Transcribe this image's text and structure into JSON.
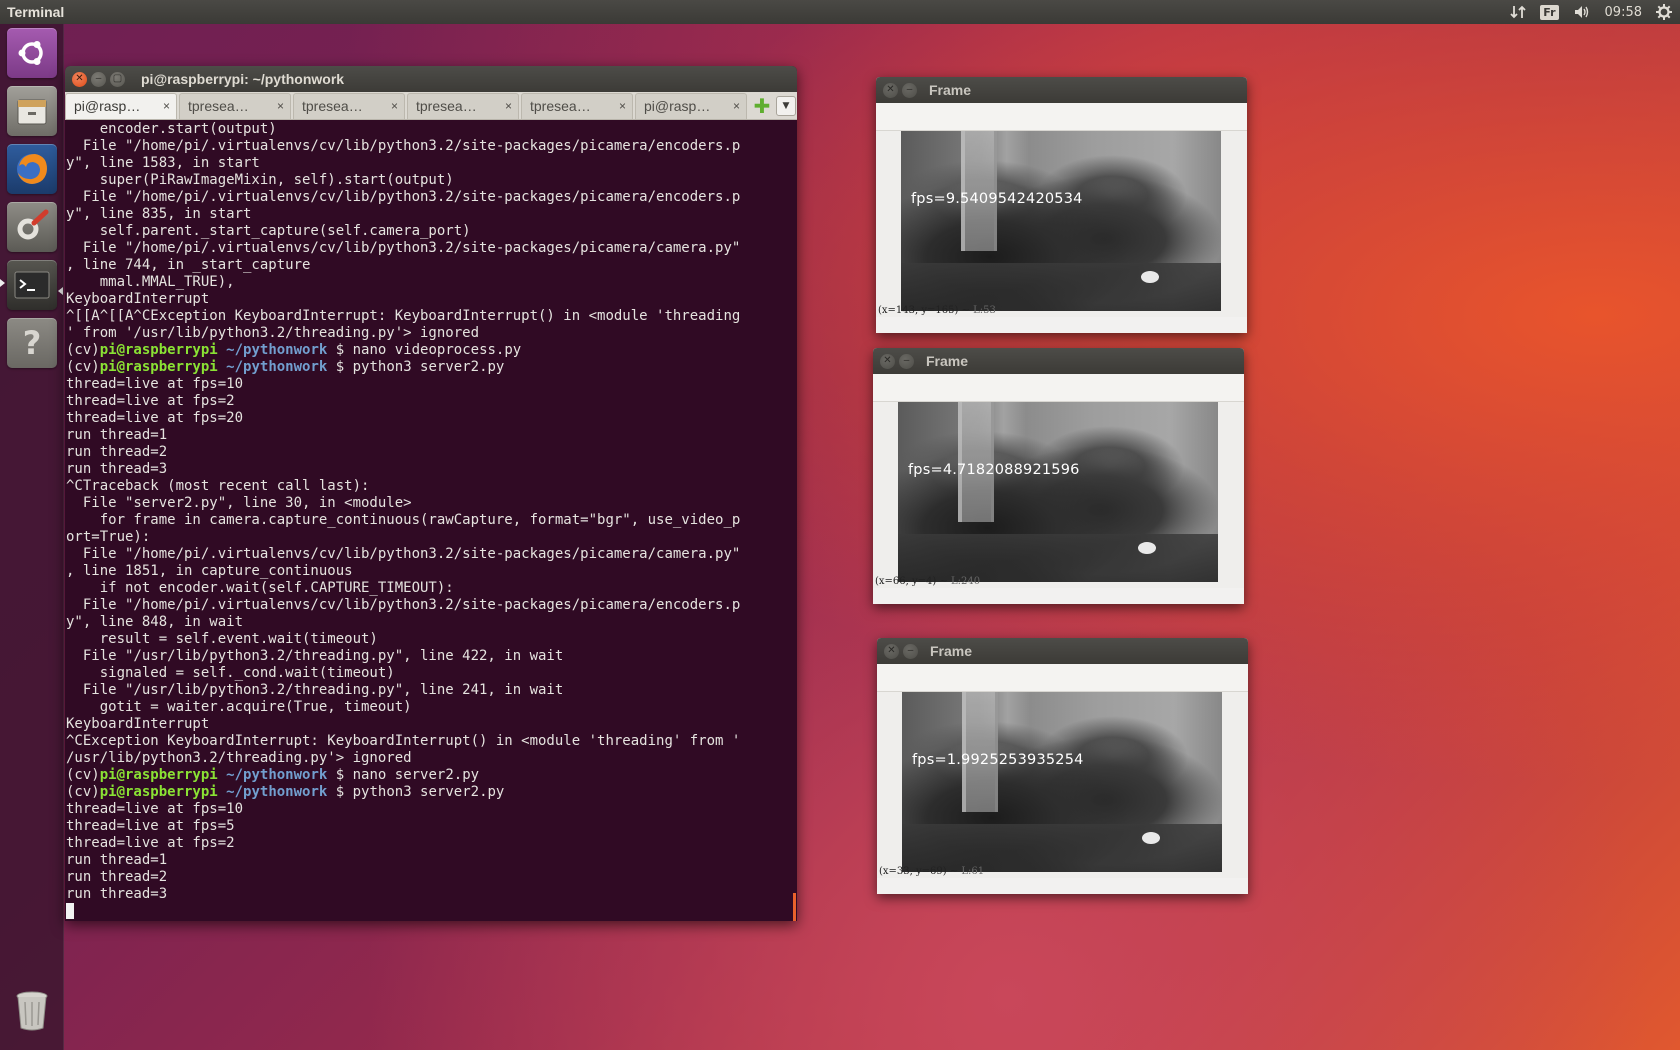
{
  "top_panel": {
    "app_title": "Terminal",
    "keyboard_layout": "Fr",
    "clock": "09:58",
    "icons": [
      "network-icon",
      "keyboard-icon",
      "volume-icon",
      "gear-icon"
    ]
  },
  "launcher": {
    "items": [
      "ubuntu-logo-icon",
      "files-icon",
      "firefox-icon",
      "system-settings-icon",
      "terminal-icon",
      "help-icon",
      "trash-icon"
    ]
  },
  "terminal": {
    "title": "pi@raspberrypi: ~/pythonwork",
    "tabs": [
      {
        "label": "pi@rasp…",
        "active": true
      },
      {
        "label": "tpresea…",
        "active": false
      },
      {
        "label": "tpresea…",
        "active": false
      },
      {
        "label": "tpresea…",
        "active": false
      },
      {
        "label": "tpresea…",
        "active": false
      },
      {
        "label": "pi@rasp…",
        "active": false
      }
    ],
    "tab_close_glyph": "×",
    "prompt_env": "(cv)",
    "prompt_user": "pi@raspberrypi",
    "prompt_path": "~/pythonwork",
    "prompt_symbol": "$",
    "lines": [
      {
        "type": "out",
        "text": "    encoder.start(output)"
      },
      {
        "type": "out",
        "text": "  File \"/home/pi/.virtualenvs/cv/lib/python3.2/site-packages/picamera/encoders.p"
      },
      {
        "type": "out",
        "text": "y\", line 1583, in start"
      },
      {
        "type": "out",
        "text": "    super(PiRawImageMixin, self).start(output)"
      },
      {
        "type": "out",
        "text": "  File \"/home/pi/.virtualenvs/cv/lib/python3.2/site-packages/picamera/encoders.p"
      },
      {
        "type": "out",
        "text": "y\", line 835, in start"
      },
      {
        "type": "out",
        "text": "    self.parent._start_capture(self.camera_port)"
      },
      {
        "type": "out",
        "text": "  File \"/home/pi/.virtualenvs/cv/lib/python3.2/site-packages/picamera/camera.py\""
      },
      {
        "type": "out",
        "text": ", line 744, in _start_capture"
      },
      {
        "type": "out",
        "text": "    mmal.MMAL_TRUE),"
      },
      {
        "type": "out",
        "text": "KeyboardInterrupt"
      },
      {
        "type": "out",
        "text": "^[[A^[[A^CException KeyboardInterrupt: KeyboardInterrupt() in <module 'threading"
      },
      {
        "type": "out",
        "text": "' from '/usr/lib/python3.2/threading.py'> ignored"
      },
      {
        "type": "prompt",
        "text": " nano videoprocess.py"
      },
      {
        "type": "prompt",
        "text": " python3 server2.py"
      },
      {
        "type": "out",
        "text": "thread=live at fps=10"
      },
      {
        "type": "out",
        "text": "thread=live at fps=2"
      },
      {
        "type": "out",
        "text": "thread=live at fps=20"
      },
      {
        "type": "out",
        "text": "run thread=1"
      },
      {
        "type": "out",
        "text": "run thread=2"
      },
      {
        "type": "out",
        "text": "run thread=3"
      },
      {
        "type": "out",
        "text": "^CTraceback (most recent call last):"
      },
      {
        "type": "out",
        "text": "  File \"server2.py\", line 30, in <module>"
      },
      {
        "type": "out",
        "text": "    for frame in camera.capture_continuous(rawCapture, format=\"bgr\", use_video_p"
      },
      {
        "type": "out",
        "text": "ort=True):"
      },
      {
        "type": "out",
        "text": "  File \"/home/pi/.virtualenvs/cv/lib/python3.2/site-packages/picamera/camera.py\""
      },
      {
        "type": "out",
        "text": ", line 1851, in capture_continuous"
      },
      {
        "type": "out",
        "text": "    if not encoder.wait(self.CAPTURE_TIMEOUT):"
      },
      {
        "type": "out",
        "text": "  File \"/home/pi/.virtualenvs/cv/lib/python3.2/site-packages/picamera/encoders.p"
      },
      {
        "type": "out",
        "text": "y\", line 848, in wait"
      },
      {
        "type": "out",
        "text": "    result = self.event.wait(timeout)"
      },
      {
        "type": "out",
        "text": "  File \"/usr/lib/python3.2/threading.py\", line 422, in wait"
      },
      {
        "type": "out",
        "text": "    signaled = self._cond.wait(timeout)"
      },
      {
        "type": "out",
        "text": "  File \"/usr/lib/python3.2/threading.py\", line 241, in wait"
      },
      {
        "type": "out",
        "text": "    gotit = waiter.acquire(True, timeout)"
      },
      {
        "type": "out",
        "text": "KeyboardInterrupt"
      },
      {
        "type": "out",
        "text": "^CException KeyboardInterrupt: KeyboardInterrupt() in <module 'threading' from '"
      },
      {
        "type": "out",
        "text": "/usr/lib/python3.2/threading.py'> ignored"
      },
      {
        "type": "prompt",
        "text": " nano server2.py"
      },
      {
        "type": "prompt",
        "text": " python3 server2.py"
      },
      {
        "type": "out",
        "text": "thread=live at fps=10"
      },
      {
        "type": "out",
        "text": "thread=live at fps=5"
      },
      {
        "type": "out",
        "text": "thread=live at fps=2"
      },
      {
        "type": "out",
        "text": "run thread=1"
      },
      {
        "type": "out",
        "text": "run thread=2"
      },
      {
        "type": "out",
        "text": "run thread=3"
      },
      {
        "type": "cursor",
        "text": ""
      }
    ]
  },
  "frames": [
    {
      "title": "Frame",
      "fps_text": "fps=9.5409542420534",
      "status_coords": "(x=143, y=165) ~ ",
      "status_lum": "L:53"
    },
    {
      "title": "Frame",
      "fps_text": "fps=4.7182088921596",
      "status_coords": "(x=66, y=4) ~ ",
      "status_lum": "L:240"
    },
    {
      "title": "Frame",
      "fps_text": "fps=1.9925253935254",
      "status_coords": "(x=33, y=69) ~ ",
      "status_lum": "L:61"
    }
  ]
}
